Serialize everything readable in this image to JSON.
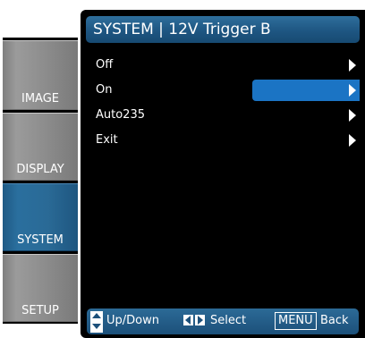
{
  "tabs": [
    {
      "label": "IMAGE"
    },
    {
      "label": "DISPLAY"
    },
    {
      "label": "SYSTEM",
      "active": true
    },
    {
      "label": "SETUP"
    }
  ],
  "title": "SYSTEM | 12V Trigger B",
  "menu": {
    "items": [
      {
        "label": "Off"
      },
      {
        "label": "On",
        "selected": true
      },
      {
        "label": "Auto235"
      },
      {
        "label": "Exit"
      }
    ]
  },
  "help": {
    "updown": "Up/Down",
    "select": "Select",
    "menu_key": "MENU",
    "back": "Back"
  },
  "colors": {
    "accent": "#1b74c4",
    "title_bar": "#1e5682",
    "active_tab": "#2a6f9e",
    "inactive_tab": "#8d8d8d"
  }
}
